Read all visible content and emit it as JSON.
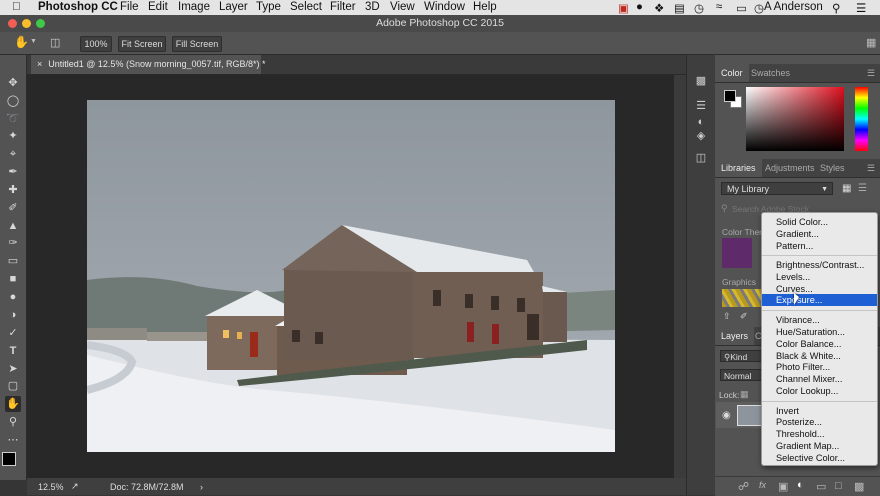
{
  "menubar": {
    "app_name": "Photoshop CC",
    "items": [
      "File",
      "Edit",
      "Image",
      "Layer",
      "Type",
      "Select",
      "Filter",
      "3D",
      "View",
      "Window",
      "Help"
    ],
    "user": "A Anderson"
  },
  "window": {
    "title": "Adobe Photoshop CC 2015"
  },
  "options_bar": {
    "zoom_btn": "100%",
    "fit_btn": "Fit Screen",
    "fill_btn": "Fill Screen"
  },
  "document": {
    "tab_title": "Untitled1 @ 12.5% (Snow morning_0057.tif, RGB/8*) *"
  },
  "status": {
    "zoom": "12.5%",
    "doc": "Doc: 72.8M/72.8M"
  },
  "color_panel": {
    "tabs": [
      "Color",
      "Swatches"
    ],
    "foreground": "#000000",
    "background": "#ffffff",
    "hue": "#e0101e"
  },
  "libraries_panel": {
    "tabs": [
      "Libraries",
      "Adjustments",
      "Styles"
    ],
    "library_select": "My Library",
    "search_placeholder": "Search Adobe Stock",
    "color_themes_label": "Color Themes",
    "graphics_label": "Graphics"
  },
  "layers_panel": {
    "tabs": [
      "Layers",
      "C"
    ],
    "kind_filter": "Kind",
    "blend_mode": "Normal",
    "lock_label": "Lock:"
  },
  "adjustment_menu": {
    "groups": [
      [
        "Solid Color...",
        "Gradient...",
        "Pattern..."
      ],
      [
        "Brightness/Contrast...",
        "Levels...",
        "Curves...",
        "Exposure..."
      ],
      [
        "Vibrance...",
        "Hue/Saturation...",
        "Color Balance...",
        "Black & White...",
        "Photo Filter...",
        "Channel Mixer...",
        "Color Lookup..."
      ],
      [
        "Invert",
        "Posterize...",
        "Threshold...",
        "Gradient Map...",
        "Selective Color..."
      ]
    ],
    "highlighted": "Exposure..."
  }
}
